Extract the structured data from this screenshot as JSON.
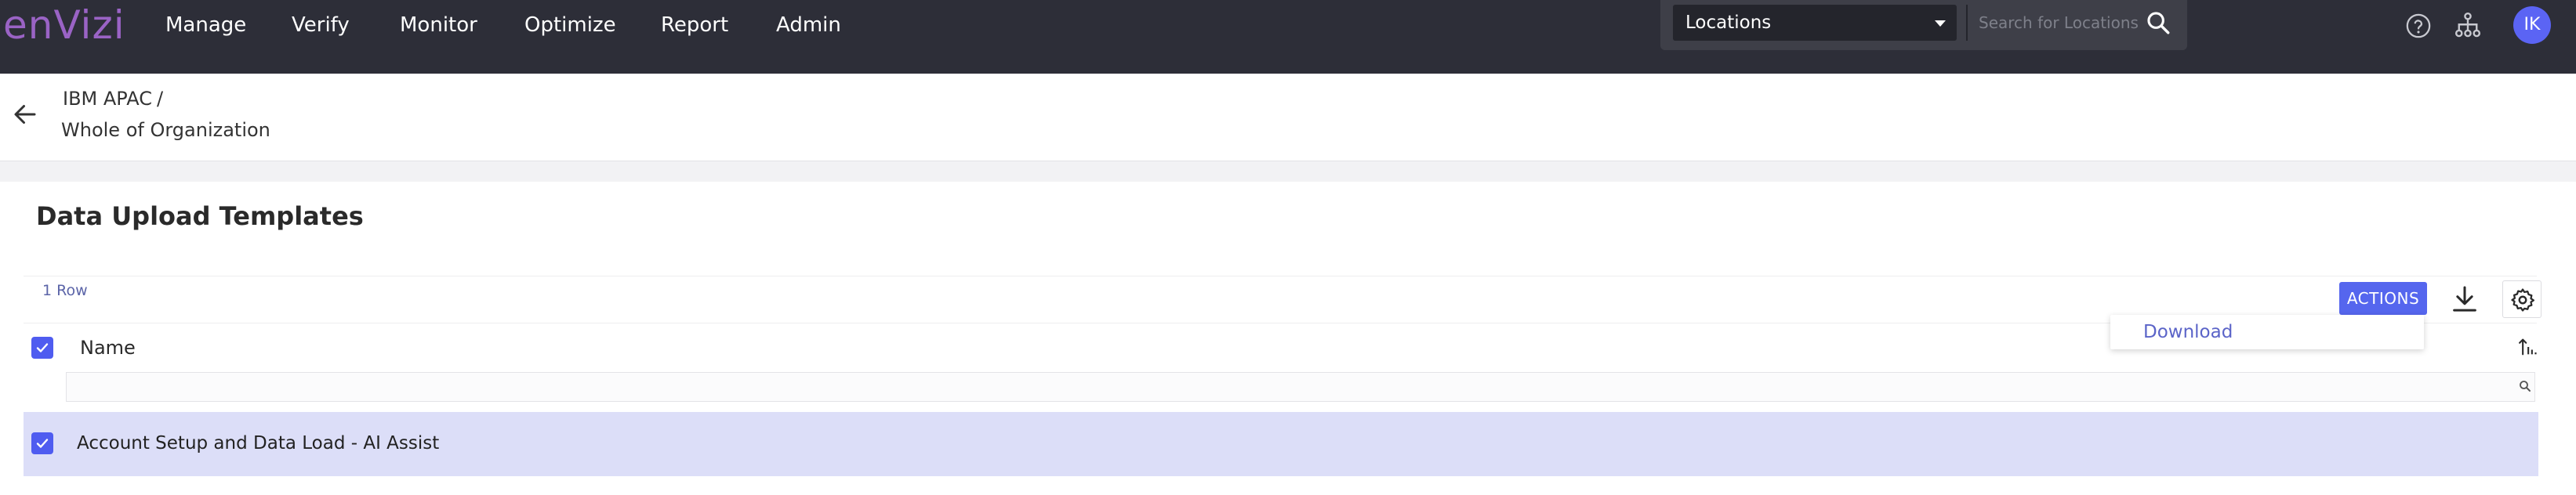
{
  "app": {
    "logo_text": "enVizi",
    "colors": {
      "topbar": "#2d2e38",
      "logo": "#9a63c5",
      "accent": "#5566ee",
      "selected_row": "#dcdef8",
      "avatar": "#5b64f4"
    }
  },
  "nav": {
    "items": [
      {
        "label": "Manage"
      },
      {
        "label": "Verify"
      },
      {
        "label": "Monitor"
      },
      {
        "label": "Optimize"
      },
      {
        "label": "Report"
      },
      {
        "label": "Admin"
      }
    ]
  },
  "search": {
    "scope_value": "Locations",
    "placeholder": "Search for Locations",
    "value": ""
  },
  "header_icons": {
    "help": "help-circle-icon",
    "hierarchy": "hierarchy-icon"
  },
  "user": {
    "initials": "IK"
  },
  "breadcrumb": {
    "parent": "IBM APAC",
    "separator": "/",
    "current": "Whole of Organization"
  },
  "page": {
    "title": "Data Upload Templates"
  },
  "grid": {
    "row_count_label": "1 Row",
    "actions_label": "ACTIONS",
    "actions_menu": [
      {
        "label": "Download"
      }
    ],
    "columns": [
      {
        "label": "Name"
      }
    ],
    "filter_value": "",
    "rows": [
      {
        "name": "Account Setup and Data Load - AI Assist",
        "selected": true
      }
    ]
  }
}
